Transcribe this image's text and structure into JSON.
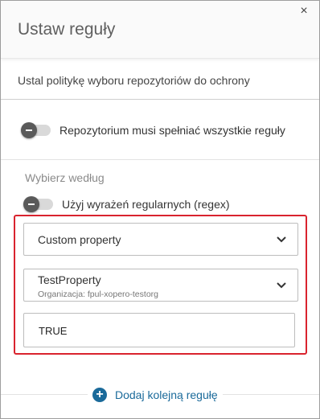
{
  "dialog": {
    "title": "Ustaw reguły",
    "close_icon": "close-icon",
    "close_glyph": "×",
    "subtitle": "Ustal politykę wyboru repozytoriów do ochrony"
  },
  "match_all_toggle": {
    "label": "Repozytorium musi spełniać wszystkie reguły",
    "state": "off"
  },
  "select_by": {
    "label": "Wybierz według",
    "regex_toggle": {
      "label": "Użyj wyrażeń regularnych (regex)",
      "state": "off"
    }
  },
  "rule": {
    "type_select": {
      "value": "Custom property"
    },
    "property_select": {
      "value": "TestProperty",
      "hint": "Organizacja: fpul-xopero-testorg"
    },
    "value_field": {
      "value": "TRUE"
    }
  },
  "add_rule": {
    "label": "Dodaj kolejną regułę",
    "icon": "plus-circle-icon",
    "color": "#1a6a9a"
  },
  "colors": {
    "highlight_border": "#d9232e",
    "toggle_knob": "#5a5a5a",
    "toggle_track": "#d9d9d9"
  }
}
